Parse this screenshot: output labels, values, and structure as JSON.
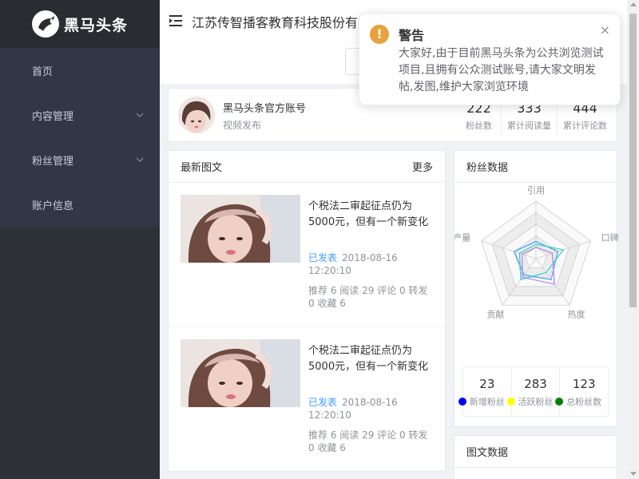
{
  "sidebar": {
    "brand": "黑马头条",
    "items": [
      {
        "label": "首页",
        "icon": "",
        "expandable": false
      },
      {
        "label": "内容管理",
        "icon": "chevron-down-icon",
        "expandable": true
      },
      {
        "label": "粉丝管理",
        "icon": "chevron-down-icon",
        "expandable": true
      },
      {
        "label": "账户信息",
        "icon": "",
        "expandable": false
      }
    ]
  },
  "header": {
    "company": "江苏传智播客教育科技股份有限公司"
  },
  "account": {
    "name": "黑马头条官方账号",
    "subtitle": "视频发布",
    "stats": [
      {
        "value": "222",
        "label": "粉丝数"
      },
      {
        "value": "333",
        "label": "累计阅读量"
      },
      {
        "value": "444",
        "label": "累计评论数"
      }
    ]
  },
  "articles": {
    "title": "最新图文",
    "more": "更多",
    "items": [
      {
        "title": "个税法二审起征点仍为5000元，但有一个新变化",
        "status": "已发表",
        "date": "2018-08-16 12:20:10",
        "stats": "推荐 6 阅读 29 评论 0 转发 0 收藏 6"
      },
      {
        "title": "个税法二审起征点仍为5000元，但有一个新变化",
        "status": "已发表",
        "date": "2018-08-16 12:20:10",
        "stats": "推荐 6 阅读 29 评论 0 转发 0 收藏 6"
      }
    ]
  },
  "fans": {
    "title": "粉丝数据",
    "radar_axes": [
      "引用",
      "口碑",
      "热度",
      "贡献",
      "产量"
    ],
    "radar_series": [
      {
        "color": "#409eff",
        "values": [
          0.3,
          0.4,
          0.45,
          0.35,
          0.4
        ]
      },
      {
        "color": "#36cfc9",
        "values": [
          0.25,
          0.5,
          0.3,
          0.45,
          0.3
        ]
      },
      {
        "color": "#b37feb",
        "values": [
          0.2,
          0.3,
          0.55,
          0.4,
          0.25
        ]
      }
    ],
    "stats": [
      {
        "value": "23",
        "label": "新增粉丝",
        "color": "#0000ff"
      },
      {
        "value": "283",
        "label": "活跃粉丝",
        "color": "#ffff00"
      },
      {
        "value": "123",
        "label": "总粉丝数",
        "color": "#008000"
      }
    ]
  },
  "content": {
    "title": "图文数据"
  },
  "notification": {
    "title": "警告",
    "icon": "!",
    "close": "×",
    "message": "大家好,由于目前黑马头条为公共浏览测试项目,且拥有公众测试账号,请大家文明发帖,发图,维护大家浏览环境"
  }
}
